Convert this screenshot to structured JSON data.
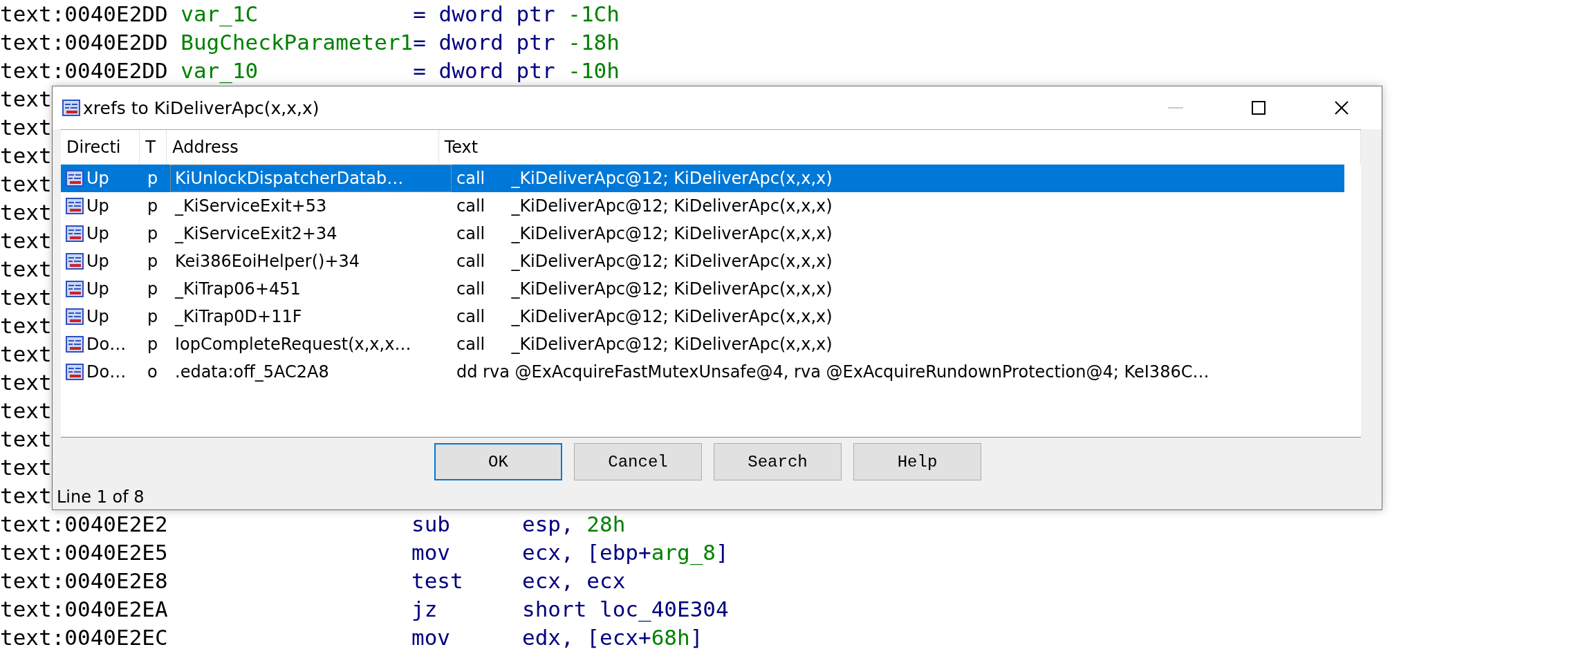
{
  "listing": [
    {
      "kind": "var",
      "address": "text:0040E2DD",
      "name": "var_1C",
      "op": "= dword ptr",
      "offset": "-1Ch"
    },
    {
      "kind": "var",
      "address": "text:0040E2DD",
      "name": "BugCheckParameter1",
      "op": "= dword ptr",
      "offset": "-18h"
    },
    {
      "kind": "var",
      "address": "text:0040E2DD",
      "name": "var_10",
      "op": "= dword ptr",
      "offset": "-10h"
    },
    {
      "kind": "covered",
      "address": "text"
    },
    {
      "kind": "covered",
      "address": "text"
    },
    {
      "kind": "covered",
      "address": "text"
    },
    {
      "kind": "covered",
      "address": "text"
    },
    {
      "kind": "covered",
      "address": "text"
    },
    {
      "kind": "covered",
      "address": "text"
    },
    {
      "kind": "covered",
      "address": "text"
    },
    {
      "kind": "covered",
      "address": "text"
    },
    {
      "kind": "covered",
      "address": "text"
    },
    {
      "kind": "covered",
      "address": "text"
    },
    {
      "kind": "covered",
      "address": "text"
    },
    {
      "kind": "covered",
      "address": "text"
    },
    {
      "kind": "covered",
      "address": "text"
    },
    {
      "kind": "covered",
      "address": "text"
    },
    {
      "kind": "covered",
      "address": "text"
    },
    {
      "kind": "instr",
      "address": "text:0040E2E2",
      "mnemonic": "sub",
      "operands": [
        {
          "kind": "reg",
          "text": "esp, "
        },
        {
          "kind": "num",
          "text": "28h"
        }
      ]
    },
    {
      "kind": "instr",
      "address": "text:0040E2E5",
      "mnemonic": "mov",
      "operands": [
        {
          "kind": "reg",
          "text": "ecx, [ebp+"
        },
        {
          "kind": "num",
          "text": "arg_8"
        },
        {
          "kind": "reg",
          "text": "]"
        }
      ]
    },
    {
      "kind": "instr",
      "address": "text:0040E2E8",
      "mnemonic": "test",
      "operands": [
        {
          "kind": "reg",
          "text": "ecx, ecx"
        }
      ]
    },
    {
      "kind": "instr",
      "address": "text:0040E2EA",
      "mnemonic": "jz",
      "operands": [
        {
          "kind": "reg",
          "text": "short loc_40E304"
        }
      ]
    },
    {
      "kind": "instr",
      "address": "text:0040E2EC",
      "mnemonic": "mov",
      "operands": [
        {
          "kind": "reg",
          "text": "edx, [ecx+"
        },
        {
          "kind": "num",
          "text": "68h"
        },
        {
          "kind": "reg",
          "text": "]"
        }
      ]
    }
  ],
  "dialog": {
    "title": "xrefs to KiDeliverApc(x,x,x)",
    "columns": [
      "Directi",
      "T",
      "Address",
      "Text"
    ],
    "rows": [
      {
        "direction": "Up",
        "type": "p",
        "address": "KiUnlockDispatcherDatab…",
        "text": "call     _KiDeliverApc@12; KiDeliverApc(x,x,x)",
        "selected": true
      },
      {
        "direction": "Up",
        "type": "p",
        "address": "_KiServiceExit+53",
        "text": "call     _KiDeliverApc@12; KiDeliverApc(x,x,x)",
        "selected": false
      },
      {
        "direction": "Up",
        "type": "p",
        "address": "_KiServiceExit2+34",
        "text": "call     _KiDeliverApc@12; KiDeliverApc(x,x,x)",
        "selected": false
      },
      {
        "direction": "Up",
        "type": "p",
        "address": "Kei386EoiHelper()+34",
        "text": "call     _KiDeliverApc@12; KiDeliverApc(x,x,x)",
        "selected": false
      },
      {
        "direction": "Up",
        "type": "p",
        "address": "_KiTrap06+451",
        "text": "call     _KiDeliverApc@12; KiDeliverApc(x,x,x)",
        "selected": false
      },
      {
        "direction": "Up",
        "type": "p",
        "address": "_KiTrap0D+11F",
        "text": "call     _KiDeliverApc@12; KiDeliverApc(x,x,x)",
        "selected": false
      },
      {
        "direction": "Do…",
        "type": "p",
        "address": "IopCompleteRequest(x,x,x…",
        "text": "call     _KiDeliverApc@12; KiDeliverApc(x,x,x)",
        "selected": false
      },
      {
        "direction": "Do…",
        "type": "o",
        "address": ".edata:off_5AC2A8",
        "text": "dd rva @ExAcquireFastMutexUnsafe@4, rva @ExAcquireRundownProtection@4; KeI386C…",
        "selected": false
      }
    ],
    "buttons": [
      {
        "label": "OK",
        "default": true
      },
      {
        "label": "Cancel",
        "default": false
      },
      {
        "label": "Search",
        "default": false
      },
      {
        "label": "Help",
        "default": false
      }
    ],
    "status": "Line 1 of 8"
  }
}
